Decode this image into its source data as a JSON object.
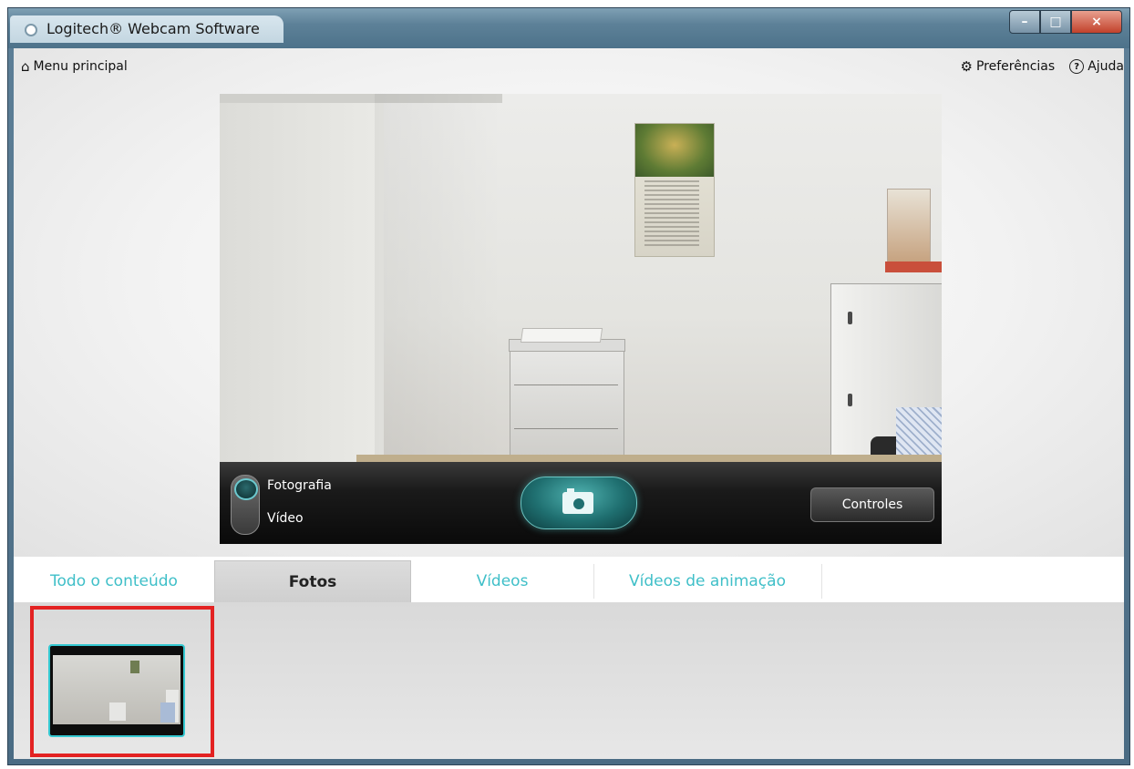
{
  "window": {
    "title": "Logitech® Webcam Software",
    "minimize_label": "–",
    "maximize_label": "□",
    "close_label": "×"
  },
  "top_nav": {
    "home_icon": "home-icon",
    "main_menu_label": "Menu principal",
    "preferences_icon": "gear-icon",
    "preferences_label": "Preferências",
    "help_icon": "help-circle-icon",
    "help_label": "Ajuda"
  },
  "capture_panel": {
    "mode_photo_label": "Fotografia",
    "mode_video_label": "Vídeo",
    "selected_mode": "Fotografia",
    "capture_icon": "camera-icon",
    "controls_label": "Controles"
  },
  "tabs": [
    {
      "label": "Todo o conteúdo",
      "active": false
    },
    {
      "label": "Fotos",
      "active": true
    },
    {
      "label": "Vídeos",
      "active": false
    },
    {
      "label": "Vídeos de animação",
      "active": false
    }
  ],
  "colors": {
    "accent": "#3fbfc8",
    "highlight": "#e32222",
    "control_bar": "#111111"
  },
  "gallery": {
    "items": [
      {
        "type": "photo",
        "selected": true
      }
    ]
  }
}
